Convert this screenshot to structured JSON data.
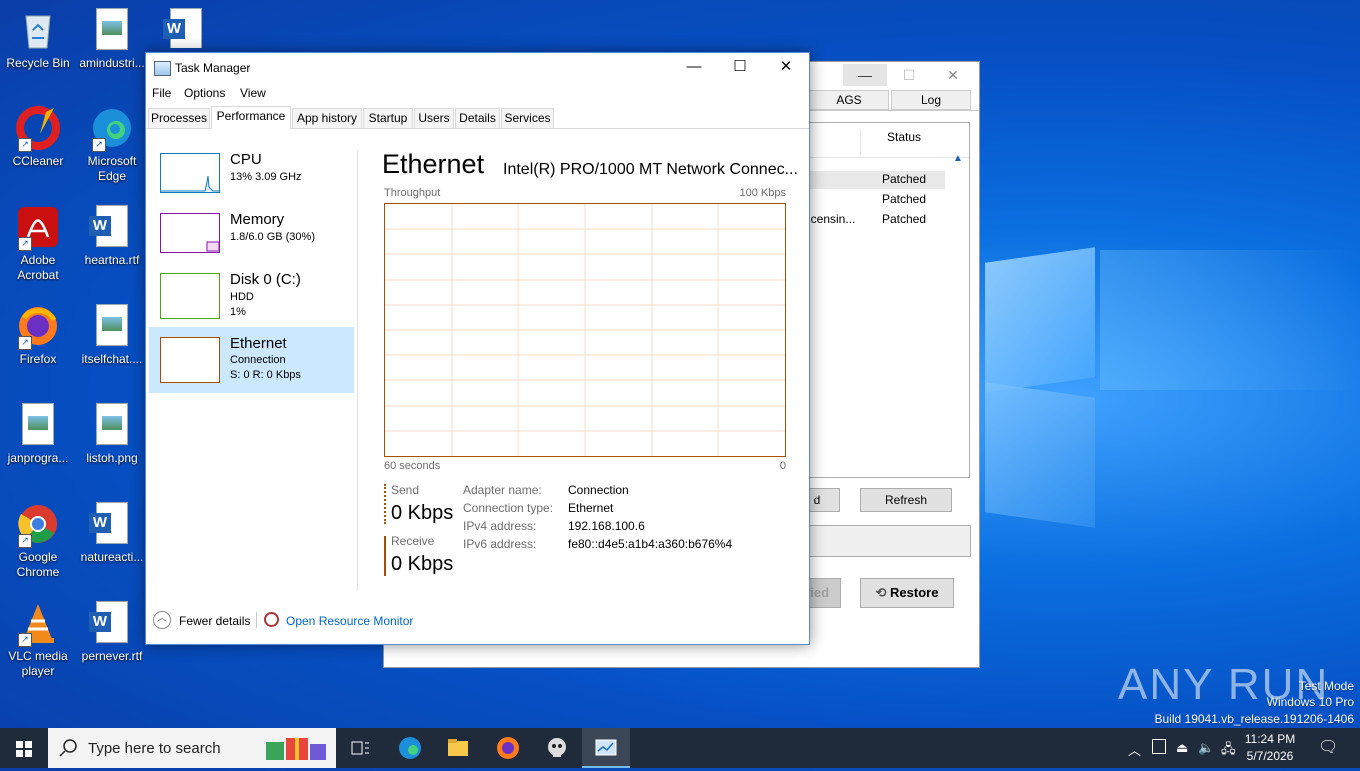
{
  "desktop": {
    "icons": [
      {
        "label": "Recycle Bin"
      },
      {
        "label": "amindustri..."
      },
      {
        "label": "CCleaner"
      },
      {
        "label": "Microsoft Edge"
      },
      {
        "label": "Adobe Acrobat"
      },
      {
        "label": "heartna.rtf"
      },
      {
        "label": "Firefox"
      },
      {
        "label": "itselfchat...."
      },
      {
        "label": "janprogra..."
      },
      {
        "label": "listoh.png"
      },
      {
        "label": "Google Chrome"
      },
      {
        "label": "natureacti..."
      },
      {
        "label": "VLC media player"
      },
      {
        "label": "pernever.rtf"
      }
    ]
  },
  "bg_window": {
    "tabs": [
      "AGS",
      "Log"
    ],
    "col_status": "Status",
    "rows": [
      {
        "name": "",
        "status": "Patched"
      },
      {
        "name": "",
        "status": "Patched"
      },
      {
        "name": "icensin...",
        "status": "Patched"
      }
    ],
    "btn_left_partial": "d",
    "refresh": "Refresh",
    "btn_modified_partial": "fied",
    "restore": "Restore"
  },
  "taskmgr": {
    "title": "Task Manager",
    "menu": [
      "File",
      "Options",
      "View"
    ],
    "tabs": [
      "Processes",
      "Performance",
      "App history",
      "Startup",
      "Users",
      "Details",
      "Services"
    ],
    "active_tab": "Performance",
    "sidebar": [
      {
        "name": "CPU",
        "line1": "13%  3.09 GHz",
        "line2": ""
      },
      {
        "name": "Memory",
        "line1": "1.8/6.0 GB (30%)",
        "line2": ""
      },
      {
        "name": "Disk 0 (C:)",
        "line1": "HDD",
        "line2": "1%"
      },
      {
        "name": "Ethernet",
        "line1": "Connection",
        "line2": "S: 0  R: 0 Kbps"
      }
    ],
    "heading": "Ethernet",
    "adapter": "Intel(R) PRO/1000 MT Network Connec...",
    "throughput_label": "Throughput",
    "max_label": "100 Kbps",
    "time_label": "60 seconds",
    "zero_label": "0",
    "send_label": "Send",
    "send_value": "0 Kbps",
    "receive_label": "Receive",
    "receive_value": "0 Kbps",
    "details": [
      {
        "k": "Adapter name:",
        "v": "Connection"
      },
      {
        "k": "Connection type:",
        "v": "Ethernet"
      },
      {
        "k": "IPv4 address:",
        "v": "192.168.100.6"
      },
      {
        "k": "IPv6 address:",
        "v": "fe80::d4e5:a1b4:a360:b676%4"
      }
    ],
    "fewer_details": "Fewer details",
    "open_monitor": "Open Resource Monitor"
  },
  "watermark": {
    "brand": "ANY RUN",
    "line1": "Test Mode",
    "line2": "Windows 10 Pro",
    "line3": "Build 19041.vb_release.191206-1406"
  },
  "taskbar": {
    "search_placeholder": "Type here to search",
    "time": "11:24 PM",
    "date": "5/7/2026"
  },
  "colors": {
    "eth_accent": "#a74f01",
    "cpu_accent": "#1179bf",
    "mem_accent": "#8b12ae",
    "disk_accent": "#4da60c",
    "selected_bg": "#cce8ff",
    "link": "#0066cc"
  }
}
